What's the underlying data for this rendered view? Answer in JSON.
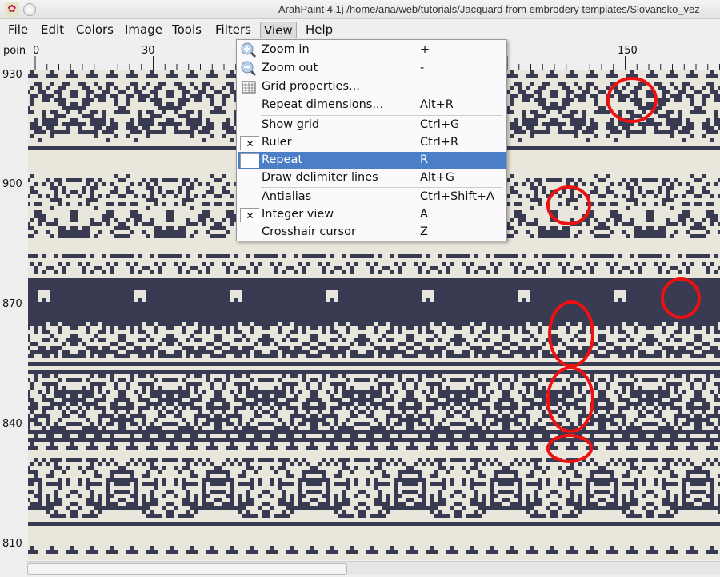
{
  "window": {
    "title": "ArahPaint 4.1j /home/ana/web/tutorials/Jacquard from embrodery templates/Slovansko_vez"
  },
  "menubar": [
    "File",
    "Edit",
    "Colors",
    "Image",
    "Tools",
    "Filters",
    "View",
    "Help"
  ],
  "ruler": {
    "unit": "poin",
    "top": [
      "0",
      "30",
      "150"
    ],
    "left": [
      "930",
      "900",
      "870",
      "840",
      "810"
    ]
  },
  "view_menu": [
    {
      "label": "Zoom in",
      "shortcut": "+",
      "icon": "zoom-in-icon"
    },
    {
      "label": "Zoom out",
      "shortcut": "-",
      "icon": "zoom-out-icon"
    },
    {
      "label": "Grid properties...",
      "shortcut": "",
      "icon": "grid-icon"
    },
    {
      "label": "Repeat dimensions...",
      "shortcut": "Alt+R"
    },
    {
      "label": "Show grid",
      "shortcut": "Ctrl+G",
      "checked": false
    },
    {
      "label": "Ruler",
      "shortcut": "Ctrl+R",
      "checked": true
    },
    {
      "label": "Repeat",
      "shortcut": "R",
      "checked": true,
      "highlighted": true
    },
    {
      "label": "Draw delimiter lines",
      "shortcut": "Alt+G"
    },
    {
      "label": "Antialias",
      "shortcut": "Ctrl+Shift+A",
      "checked": false
    },
    {
      "label": "Integer view",
      "shortcut": "A",
      "checked": true
    },
    {
      "label": "Crosshair cursor",
      "shortcut": "Z"
    }
  ],
  "colors": {
    "pattern_dark": "#383b52",
    "pattern_light": "#e9e6dc",
    "annotation": "#ee1111",
    "highlight": "#4a7fc7"
  }
}
